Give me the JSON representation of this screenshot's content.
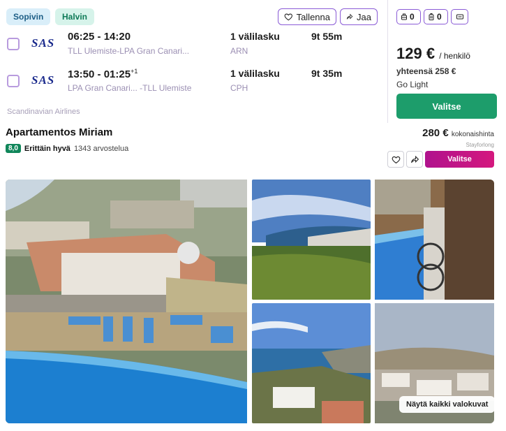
{
  "flight": {
    "badges": [
      "Sopivin",
      "Halvin"
    ],
    "save_label": "Tallenna",
    "share_label": "Jaa",
    "legs": [
      {
        "airline_logo": "SAS",
        "times": "06:25 - 14:20",
        "day_offset": "",
        "route": "TLL Ulemiste-LPA Gran Canari...",
        "stops": "1 välilasku",
        "via": "ARN",
        "duration": "9t 55m"
      },
      {
        "airline_logo": "SAS",
        "times": "13:50 - 01:25",
        "day_offset": "+1",
        "route": "LPA Gran Canari... -TLL Ulemiste",
        "stops": "1 välilasku",
        "via": "CPH",
        "duration": "9t 35m"
      }
    ],
    "carrier": "Scandinavian Airlines",
    "bags": {
      "carry_on": "0",
      "checked": "0"
    },
    "price": "129 €",
    "price_unit": "/ henkilö",
    "total": "yhteensä 258 €",
    "fare_class": "Go Light",
    "select_label": "Valitse"
  },
  "hotel": {
    "name": "Apartamentos Miriam",
    "score": "8,0",
    "score_word": "Erittäin hyvä",
    "reviews": "1343 arvostelua",
    "price": "280 €",
    "price_label": "kokonaishinta",
    "provider": "Stayforlong",
    "select_label": "Valitse",
    "show_all_photos": "Näytä kaikki valokuvat"
  },
  "colors": {
    "accent_purple": "#8a5bd6",
    "select_green": "#1d9d6b",
    "select_pink": "#c4157f",
    "rating_green": "#10865a"
  }
}
